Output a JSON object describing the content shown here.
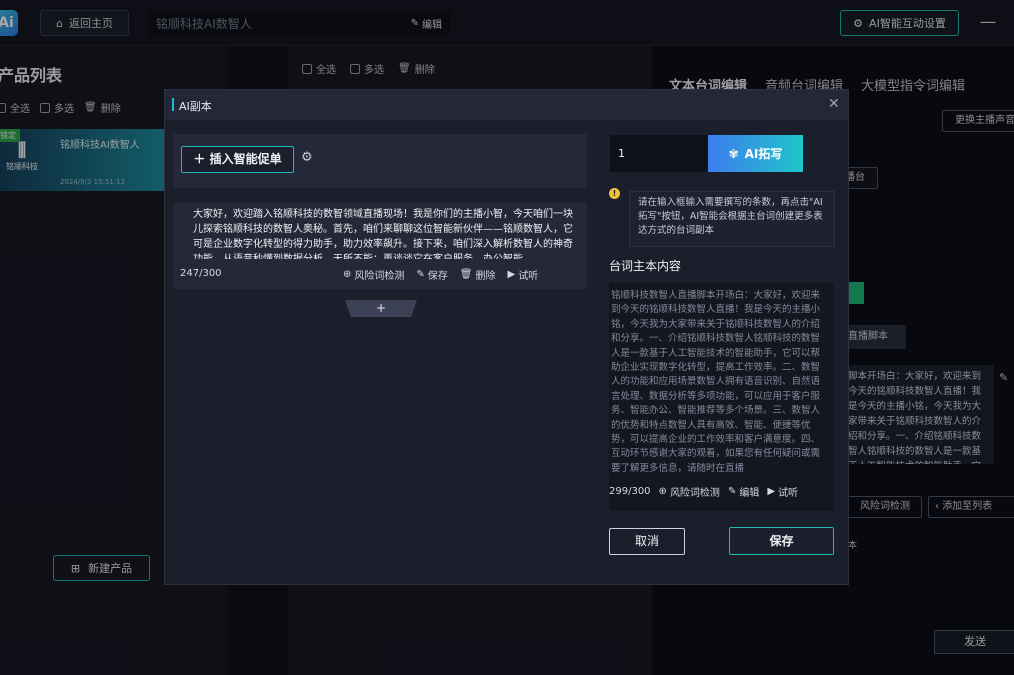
{
  "topbar": {
    "logo": "Ai",
    "home_label": "返回主页",
    "title": "铭顺科技AI数智人",
    "edit_label": "编辑",
    "ai_setting_label": "AI智能互动设置",
    "minimize": "—"
  },
  "left": {
    "title": "产品列表",
    "select_all": "全选",
    "multi": "多选",
    "delete": "删除",
    "product": {
      "tag": "锁定",
      "name": "铭顺科技AI数智人",
      "date": "2024/9/3 15:51:12",
      "logo_text": "铭顺科技"
    },
    "new_product": "新建产品"
  },
  "middle": {
    "select_all": "全选",
    "multi": "多选",
    "delete": "删除"
  },
  "right": {
    "tabs": [
      "文本台词编辑",
      "音频台词编辑",
      "大模型指令词编辑"
    ],
    "voice_btn": "更换主播声音",
    "chip": "播台",
    "live_script_btn": "直播脚本",
    "script_text": "脚本开场白：大家好，欢迎来到今天的铭顺科技数智人直播！我是今天的主播小铭，今天我为大家带来关于铭顺科技数智人的介绍和分享。一、介绍铭顺科技数智人铭顺科技的数智人是一款基于人工智能技术的智能助手，它可以帮助企业实现数字化转型，提高工作效率。二、数智人的功能和应用场景数智人拥有语音识别、",
    "risk_btn": "风险词检测",
    "add_list_btn": "添加至列表",
    "ben": "本",
    "send_btn": "发送"
  },
  "modal": {
    "title": "AI副本",
    "insert_btn": "插入智能促单",
    "script": {
      "text": "大家好，欢迎踏入铭顺科技的数智领域直播现场！我是你们的主播小智，今天咱们一块儿探索铭顺科技的数智人奥秘。首先，咱们来聊聊这位智能新伙伴——铭顺数智人，它可是企业数字化转型的得力助手，助力效率飙升。接下来，咱们深入解析数智人的神奇功能，从语音秒懂到数据分析，无所不能；再谈谈它在客户服务、办公智能",
      "count": "247/300",
      "risk": "风险词检测",
      "save": "保存",
      "delete": "删除",
      "listen": "试听"
    },
    "add_symbol": "+",
    "number_input": "1",
    "expand_btn": "AI拓写",
    "info": "请在输入框输入需要撰写的条数，再点击\"AI拓写\"按钮，AI智能会根据主台词创建更多表达方式的台词副本",
    "main_label": "台词主本内容",
    "main_text": "铭顺科技数智人直播脚本开场白：大家好，欢迎来到今天的铭顺科技数智人直播！我是今天的主播小铭，今天我为大家带来关于铭顺科技数智人的介绍和分享。一、介绍铭顺科技数智人铭顺科技的数智人是一款基于人工智能技术的智能助手，它可以帮助企业实现数字化转型，提高工作效率。二、数智人的功能和应用场景数智人拥有语音识别、自然语言处理、数据分析等多项功能，可以应用于客户服务、智能办公、智能推荐等多个场景。三、数智人的优势和特点数智人具有高效、智能、便捷等优势，可以提高企业的工作效率和客户满意度。四、互动环节感谢大家的观看，如果您有任何疑问或需要了解更多信息，请随时在直播",
    "main_count": "299/300",
    "main_risk": "风险词检测",
    "main_edit": "编辑",
    "main_listen": "试听",
    "cancel": "取消",
    "save": "保存"
  }
}
